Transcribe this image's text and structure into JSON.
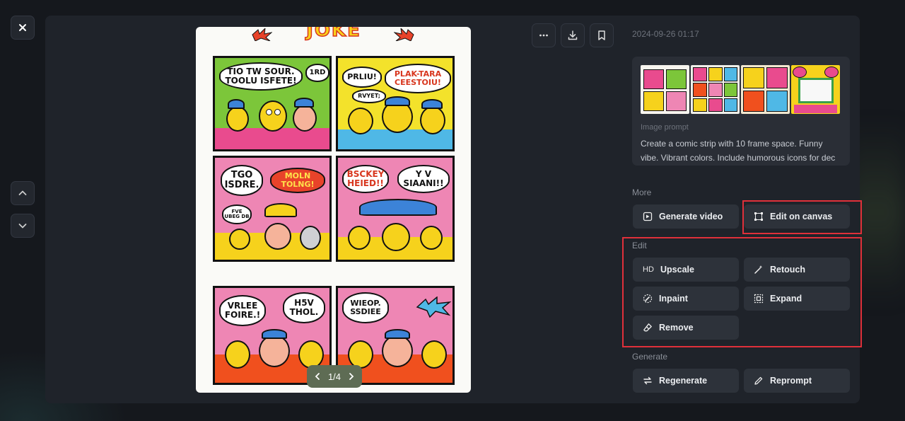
{
  "window": {
    "close_icon": "close-icon",
    "nav_up_icon": "chevron-up-icon",
    "nav_down_icon": "chevron-down-icon"
  },
  "viewer": {
    "pager": {
      "current": 1,
      "total": 4,
      "label": "1/4"
    },
    "comic_text": {
      "title": "JOKE",
      "f1_b1": "TIO TW SOUR. TOOLU ISFETE!",
      "f1_b2": "1RD",
      "f2_b1": "PRLIU!",
      "f2_b2": "PLAK-TARA CEESTOIU!",
      "f2_b3": "RVYET;",
      "f3_b1": "TGO ISDRE.",
      "f3_b2": "MOLN TOLNG!",
      "f3_b3": "FVE UBEG DB",
      "f4_b1": "BSCKEY HEIED!!",
      "f4_b2": "Y V SIAANI!!",
      "f5_b1": "VRLEE FOIRE.!",
      "f5_b2": "H5V THOL.",
      "f6_b1": "WIEOP. SSDIEE"
    }
  },
  "toolbar": {
    "more_icon": "more-horizontal-icon",
    "download_icon": "download-icon",
    "bookmark_icon": "bookmark-icon"
  },
  "sidebar": {
    "date": "2024-09-26 01:17",
    "prompt_label": "Image prompt",
    "prompt_text": "Create a comic strip with 10 frame space. Funny vibe. Vibrant colors. Include humorous icons for dec",
    "sections": {
      "more": "More",
      "edit": "Edit",
      "generate": "Generate"
    },
    "more_actions": {
      "generate_video": "Generate video",
      "edit_on_canvas": "Edit on canvas"
    },
    "edit_actions": {
      "upscale_prefix": "HD",
      "upscale": "Upscale",
      "retouch": "Retouch",
      "inpaint": "Inpaint",
      "expand": "Expand",
      "remove": "Remove"
    },
    "generate_actions": {
      "regenerate": "Regenerate",
      "reprompt": "Reprompt"
    }
  },
  "colors": {
    "highlight": "#e0303a",
    "panel_bg": "#1f232a",
    "button_bg": "#2d323a"
  }
}
